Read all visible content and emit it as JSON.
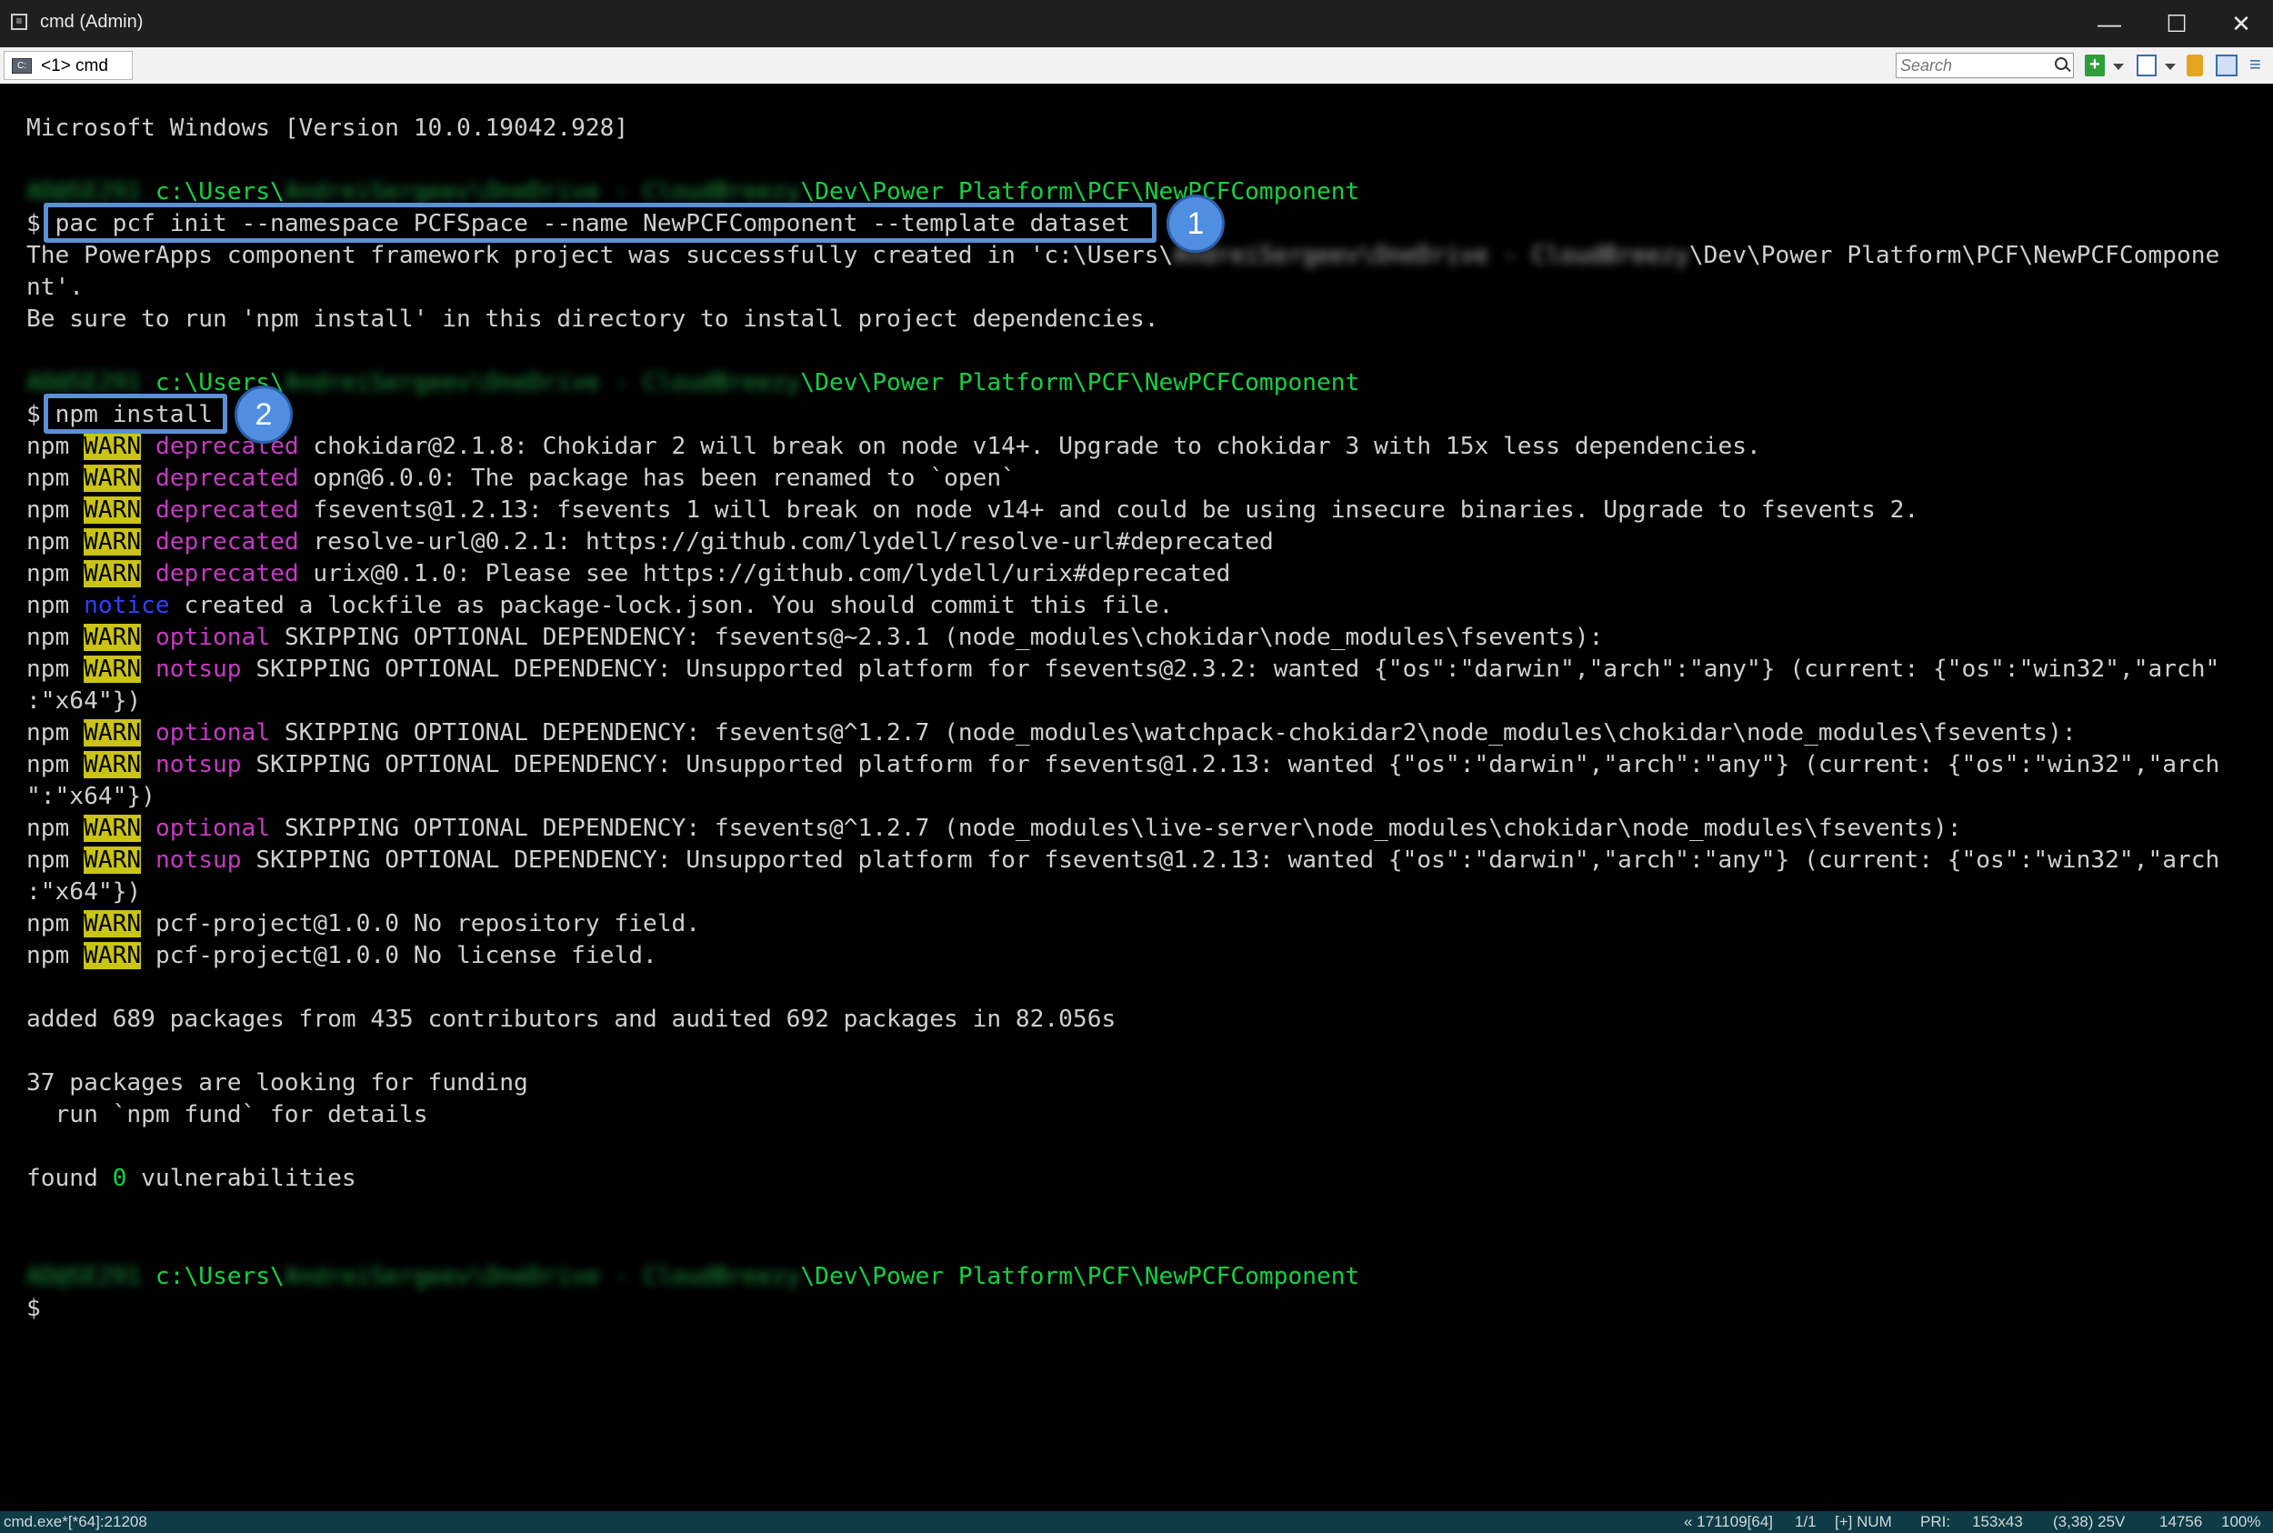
{
  "window": {
    "title": "cmd (Admin)",
    "minimize": "—",
    "maximize": "☐",
    "close": "✕"
  },
  "tabs": [
    {
      "label": "<1> cmd"
    }
  ],
  "search": {
    "placeholder": "Search"
  },
  "console": {
    "version_line": "Microsoft Windows [Version 10.0.19042.928]",
    "prompt_blur_host": "AD@SE291",
    "prompt_blur_user": "AndreiSergeev\\OneDrive - CloudBreezy",
    "prompt_prefix": " c:\\Users\\",
    "prompt_suffix": "\\Dev\\Power Platform\\PCF\\NewPCFComponent",
    "dollar": "$",
    "cmd1": "pac pcf init --namespace PCFSpace --name NewPCFComponent --template dataset",
    "out1_a": "The PowerApps component framework project was successfully created in 'c:\\Users\\",
    "out1_b": "\\Dev\\Power Platform\\PCF\\NewPCFCompone",
    "out1_c": "nt'.",
    "out1_d": "Be sure to run 'npm install' in this directory to install project dependencies.",
    "cmd2": "npm install",
    "npm": "npm",
    "warn": "WARN",
    "deprecated": "deprecated",
    "notice": "notice",
    "optional": "optional",
    "notsup": "notsup",
    "w1": " chokidar@2.1.8: Chokidar 2 will break on node v14+. Upgrade to chokidar 3 with 15x less dependencies.",
    "w2": " opn@6.0.0: The package has been renamed to `open`",
    "w3": " fsevents@1.2.13: fsevents 1 will break on node v14+ and could be using insecure binaries. Upgrade to fsevents 2.",
    "w4": " resolve-url@0.2.1: https://github.com/lydell/resolve-url#deprecated",
    "w5": " urix@0.1.0: Please see https://github.com/lydell/urix#deprecated",
    "n1": " created a lockfile as package-lock.json. You should commit this file.",
    "o1": " SKIPPING OPTIONAL DEPENDENCY: fsevents@~2.3.1 (node_modules\\chokidar\\node_modules\\fsevents):",
    "s1a": " SKIPPING OPTIONAL DEPENDENCY: Unsupported platform for fsevents@2.3.2: wanted {\"os\":\"darwin\",\"arch\":\"any\"} (current: {\"os\":\"win32\",\"arch\"",
    "s1b": ":\"x64\"})",
    "o2": " SKIPPING OPTIONAL DEPENDENCY: fsevents@^1.2.7 (node_modules\\watchpack-chokidar2\\node_modules\\chokidar\\node_modules\\fsevents):",
    "s2a": " SKIPPING OPTIONAL DEPENDENCY: Unsupported platform for fsevents@1.2.13: wanted {\"os\":\"darwin\",\"arch\":\"any\"} (current: {\"os\":\"win32\",\"arch",
    "s2b": "\":\"x64\"})",
    "o3": " SKIPPING OPTIONAL DEPENDENCY: fsevents@^1.2.7 (node_modules\\live-server\\node_modules\\chokidar\\node_modules\\fsevents):",
    "s3a": " SKIPPING OPTIONAL DEPENDENCY: Unsupported platform for fsevents@1.2.13: wanted {\"os\":\"darwin\",\"arch\":\"any\"} (current: {\"os\":\"win32\",\"arch",
    "s3b": ":\"x64\"})",
    "p1": " pcf-project@1.0.0 No repository field.",
    "p2": " pcf-project@1.0.0 No license field.",
    "added": "added 689 packages from 435 contributors and audited 692 packages in 82.056s",
    "funding1": "37 packages are looking for funding",
    "funding2": "  run `npm fund` for details",
    "found_a": "found ",
    "found_num": "0",
    "found_b": " vulnerabilities"
  },
  "annotations": {
    "badge1": "1",
    "badge2": "2"
  },
  "statusbar": {
    "left": "cmd.exe*[*64]:21208",
    "pos": "« 171109[64]",
    "page": "1/1",
    "mode": "[+] NUM",
    "pri": "PRI:",
    "size": "153x43",
    "cursor": "(3,38) 25V",
    "mem": "14756",
    "zoom": "100%"
  }
}
